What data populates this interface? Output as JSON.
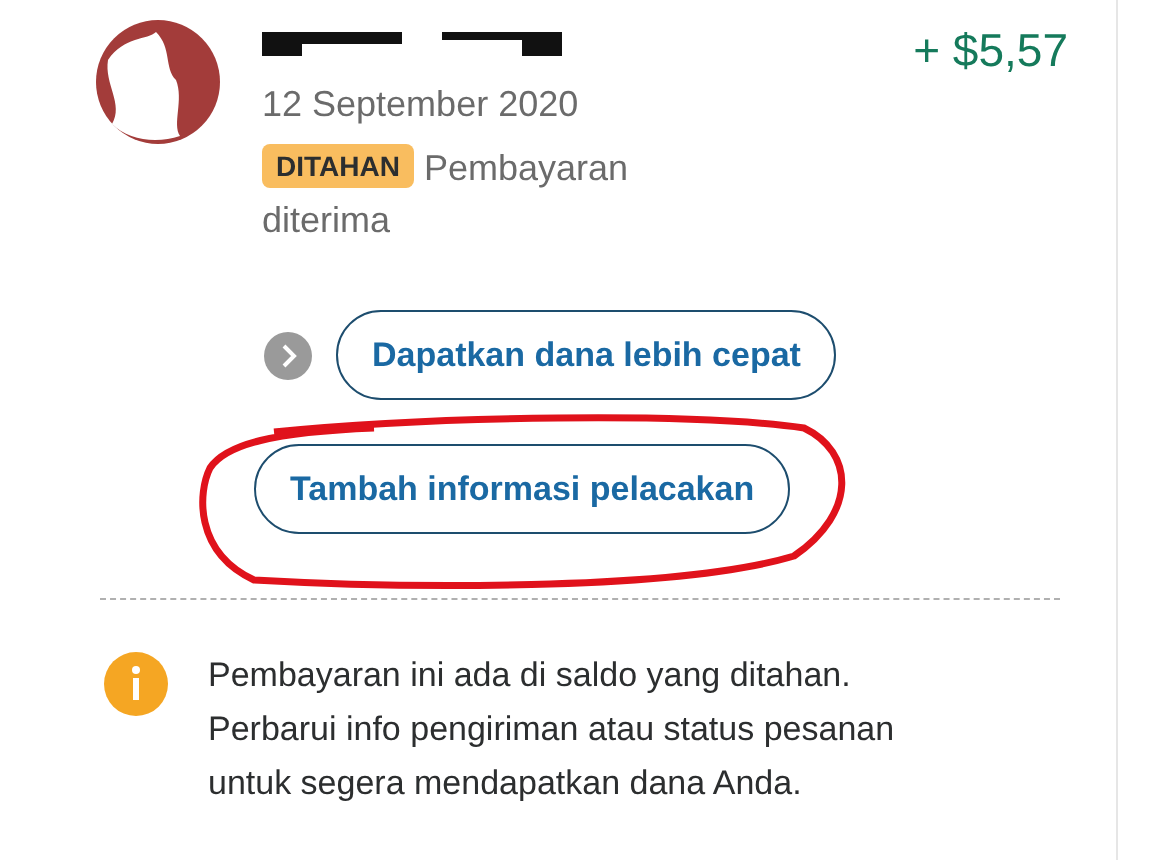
{
  "transaction": {
    "amount": "+ $5,57",
    "date": "12 September 2020",
    "status_badge": "DITAHAN",
    "status_text_lines": [
      "Pembayaran",
      "diterima"
    ]
  },
  "actions": [
    {
      "label": "Dapatkan dana lebih cepat",
      "kind": "chevron",
      "annotated": false
    },
    {
      "label": "Tambah informasi pelacakan",
      "kind": "plain",
      "annotated": true
    }
  ],
  "notice": {
    "text": "Pembayaran ini ada di saldo yang ditahan. Perbarui info pengiriman atau status pesanan untuk segera mendapatkan dana Anda."
  }
}
